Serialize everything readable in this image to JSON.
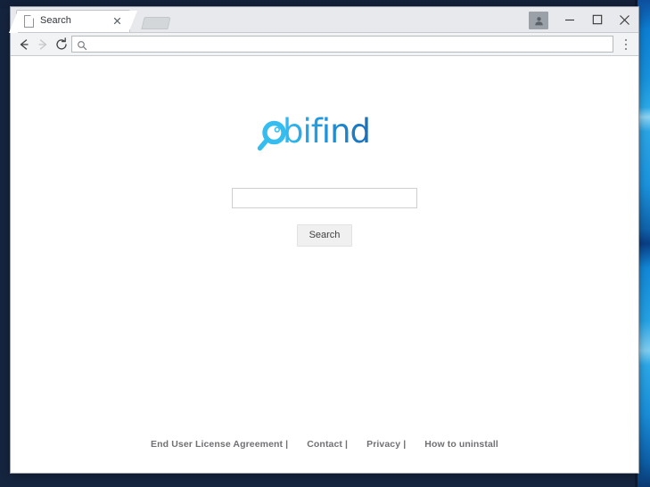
{
  "window": {
    "controls": {
      "profile_icon": "user-profile-icon",
      "minimize_label": "—",
      "maximize_label": "□",
      "close_label": "✕"
    }
  },
  "tabstrip": {
    "tab_title": "Search",
    "tab_favicon": "page-icon",
    "close_icon": "close-icon",
    "new_tab_icon": "new-tab-button"
  },
  "toolbar": {
    "back_icon": "back-arrow-icon",
    "forward_icon": "forward-arrow-icon",
    "reload_icon": "reload-icon",
    "url_search_icon": "search-icon",
    "url_value": "",
    "url_placeholder": "",
    "menu_icon": "three-dot-menu-icon"
  },
  "page": {
    "logo": {
      "text": "obifind",
      "letters": "obifind",
      "magnifier_icon": "magnifier-o-icon",
      "color_start": "#2fb6ee",
      "color_end": "#1a6fb8"
    },
    "search": {
      "input_value": "",
      "input_placeholder": "",
      "button_label": "Search"
    },
    "footer": {
      "links": [
        {
          "label": "End User License Agreement |"
        },
        {
          "label": "Contact |"
        },
        {
          "label": "Privacy |"
        },
        {
          "label": "How to uninstall"
        }
      ]
    }
  }
}
